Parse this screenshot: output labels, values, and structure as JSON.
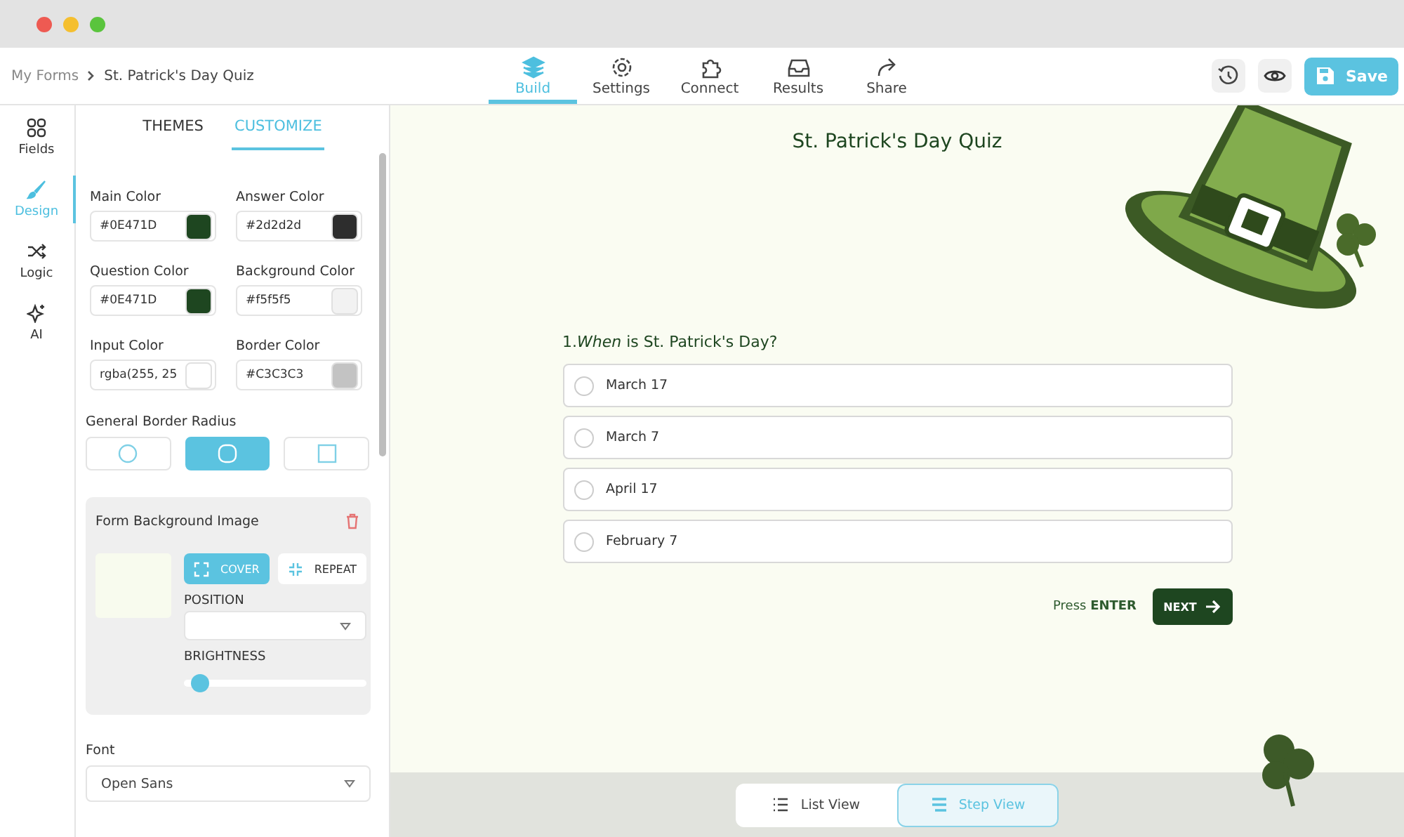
{
  "breadcrumb": [
    "My Forms",
    "St. Patrick's Day Quiz"
  ],
  "nav_tabs": [
    {
      "label": "Build",
      "selected": true
    },
    {
      "label": "Settings",
      "selected": false
    },
    {
      "label": "Connect",
      "selected": false
    },
    {
      "label": "Results",
      "selected": false
    },
    {
      "label": "Share",
      "selected": false
    }
  ],
  "save_button": "Save",
  "rail": [
    {
      "label": "Fields",
      "selected": false
    },
    {
      "label": "Design",
      "selected": true
    },
    {
      "label": "Logic",
      "selected": false
    },
    {
      "label": "AI",
      "selected": false
    }
  ],
  "panel_tabs": [
    {
      "label": "THEMES",
      "selected": false
    },
    {
      "label": "CUSTOMIZE",
      "selected": true
    }
  ],
  "color_fields": [
    {
      "label": "Main Color",
      "value": "#0E471D",
      "color": "#1e4620"
    },
    {
      "label": "Answer Color",
      "value": "#2d2d2d",
      "color": "#2d2d2d"
    },
    {
      "label": "Question Color",
      "value": "#0E471D",
      "color": "#1e4620"
    },
    {
      "label": "Background Color",
      "value": "#f5f5f5",
      "color": "#f2f2f2"
    },
    {
      "label": "Input Color",
      "value": "rgba(255, 25",
      "color": "#ffffff"
    },
    {
      "label": "Border Color",
      "value": "#C3C3C3",
      "color": "#c3c3c3"
    }
  ],
  "border_radius": {
    "label": "General Border Radius",
    "options": [
      {
        "kind": "circle",
        "selected": false
      },
      {
        "kind": "rounded",
        "selected": true
      },
      {
        "kind": "square",
        "selected": false
      }
    ]
  },
  "background_image": {
    "title": "Form Background Image",
    "fit_buttons": [
      {
        "label": "COVER",
        "kind": "cover",
        "selected": true
      },
      {
        "label": "REPEAT",
        "kind": "repeat",
        "selected": false
      }
    ],
    "position_label": "POSITION",
    "brightness_label": "BRIGHTNESS",
    "brightness": {
      "level": 0.05
    }
  },
  "font": {
    "label": "Font",
    "value": "Open Sans"
  },
  "form": {
    "title": "St. Patrick's Day Quiz",
    "question_number": "1.",
    "question": "*When* is St. Patrick's Day?",
    "options": [
      {
        "label": "March 17",
        "selected": false
      },
      {
        "label": "March 7",
        "selected": false
      },
      {
        "label": "April 17",
        "selected": false
      },
      {
        "label": "February 7",
        "selected": false
      }
    ],
    "hint": "Press **ENTER**",
    "next_button": "NEXT"
  },
  "view_toggle": [
    {
      "label": "List View",
      "selected": false
    },
    {
      "label": "Step View",
      "selected": true
    }
  ]
}
